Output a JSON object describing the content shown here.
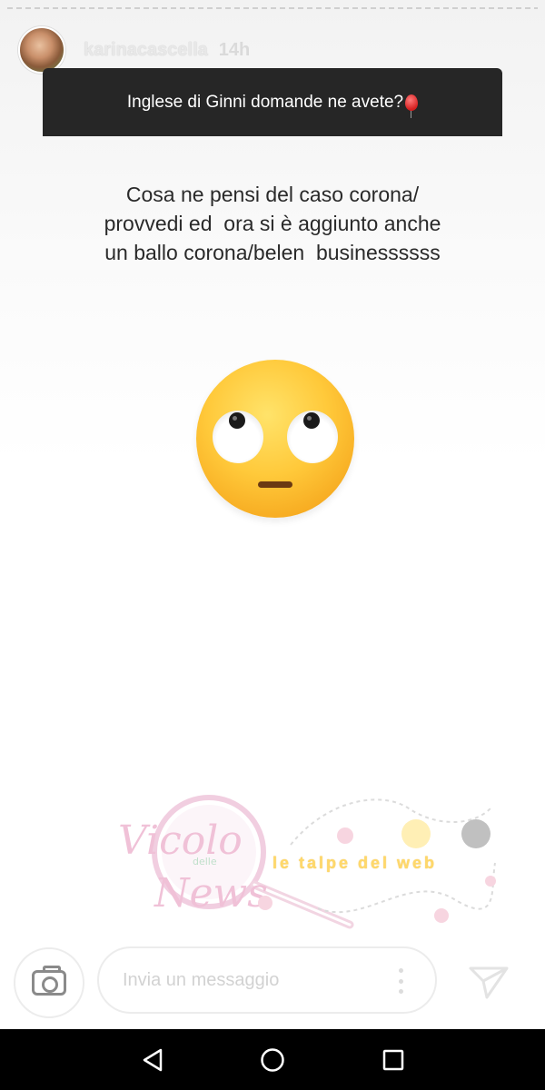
{
  "story": {
    "username": "karinacascella",
    "time": "14h"
  },
  "question": {
    "text": "Inglese di Ginni domande ne avete?",
    "icon": "balloon-icon"
  },
  "answer": {
    "lines": [
      "Cosa ne pensi del caso corona/",
      "provvedi ed  ora si è aggiunto anche",
      "un ballo corona/belen  businessssss"
    ],
    "emoji": "face-with-rolling-eyes"
  },
  "watermark": {
    "logo_line1": "Vicolo",
    "logo_small": "delle",
    "logo_line2": "News",
    "tagline": "le talpe del web"
  },
  "reply_bar": {
    "placeholder": "Invia un messaggio",
    "camera_icon": "camera-icon",
    "more_icon": "more-vertical-icon",
    "send_icon": "send-icon"
  },
  "nav": {
    "back_icon": "back-icon",
    "home_icon": "home-icon",
    "recent_icon": "recent-apps-icon"
  },
  "colors": {
    "question_bg": "#262626",
    "nav_bg": "#000000"
  }
}
